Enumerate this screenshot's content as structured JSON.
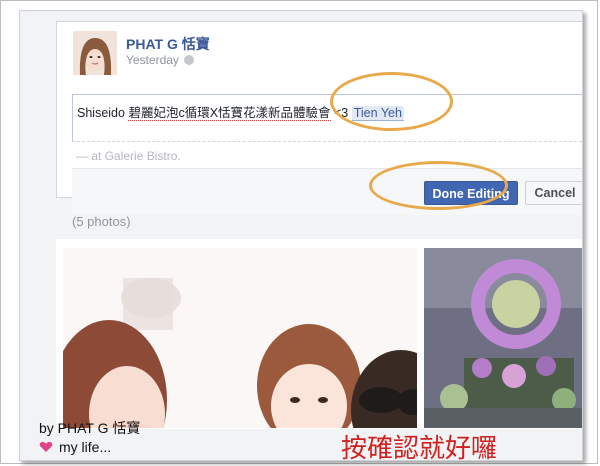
{
  "post": {
    "author": "PHAT G 恬寶",
    "timestamp": "Yesterday",
    "edit_text_start": "Shiseido ",
    "edit_text_misspelled": "碧麗妃泡c循環X恬寶花漾新品體驗會",
    "edit_text_heart": " <3 ",
    "tag": "Tien Yeh",
    "location": "— at Galerie Bistro.",
    "done_label": "Done Editing",
    "cancel_label": "Cancel",
    "photo_count": "(5 photos)"
  },
  "watermark": {
    "line1": "by PHAT G 恬寶",
    "line2": "my life..."
  },
  "caption": "按確認就好囉",
  "colors": {
    "accent": "#3b5998",
    "primary_button": "#4267b2",
    "highlight": "#e8a94a",
    "caption": "#d02020"
  }
}
